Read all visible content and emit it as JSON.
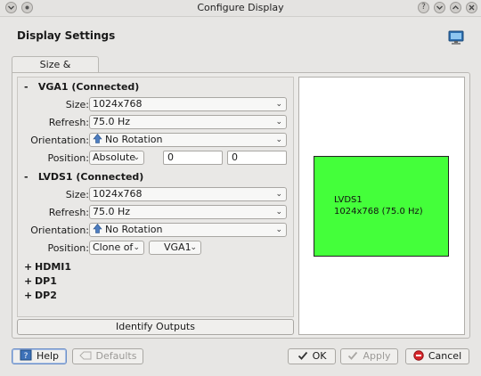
{
  "window": {
    "title": "Configure Display"
  },
  "page": {
    "heading": "Display Settings"
  },
  "tabs": [
    {
      "label": "Size & Orientation"
    }
  ],
  "outputs": {
    "vga1": {
      "header": "VGA1 (Connected)",
      "size_label": "Size:",
      "size": "1024x768",
      "refresh_label": "Refresh:",
      "refresh": "75.0 Hz",
      "orientation_label": "Orientation:",
      "orientation": "No Rotation",
      "position_label": "Position:",
      "position_mode": "Absolute",
      "pos_x": "0",
      "pos_y": "0"
    },
    "lvds1": {
      "header": "LVDS1 (Connected)",
      "size_label": "Size:",
      "size": "1024x768",
      "refresh_label": "Refresh:",
      "refresh": "75.0 Hz",
      "orientation_label": "Orientation:",
      "orientation": "No Rotation",
      "position_label": "Position:",
      "position_mode": "Clone of",
      "clone_target": "VGA1"
    },
    "collapsed": [
      "HDMI1",
      "DP1",
      "DP2"
    ]
  },
  "identify_button": "Identify Outputs",
  "preview": {
    "screen_name": "LVDS1",
    "screen_info": "1024x768 (75.0 Hz)",
    "screen_color": "#44ff3a"
  },
  "footer": {
    "help": "Help",
    "defaults": "Defaults",
    "ok": "OK",
    "apply": "Apply",
    "cancel": "Cancel"
  },
  "symbols": {
    "expanded": "-",
    "collapsed": "+"
  }
}
